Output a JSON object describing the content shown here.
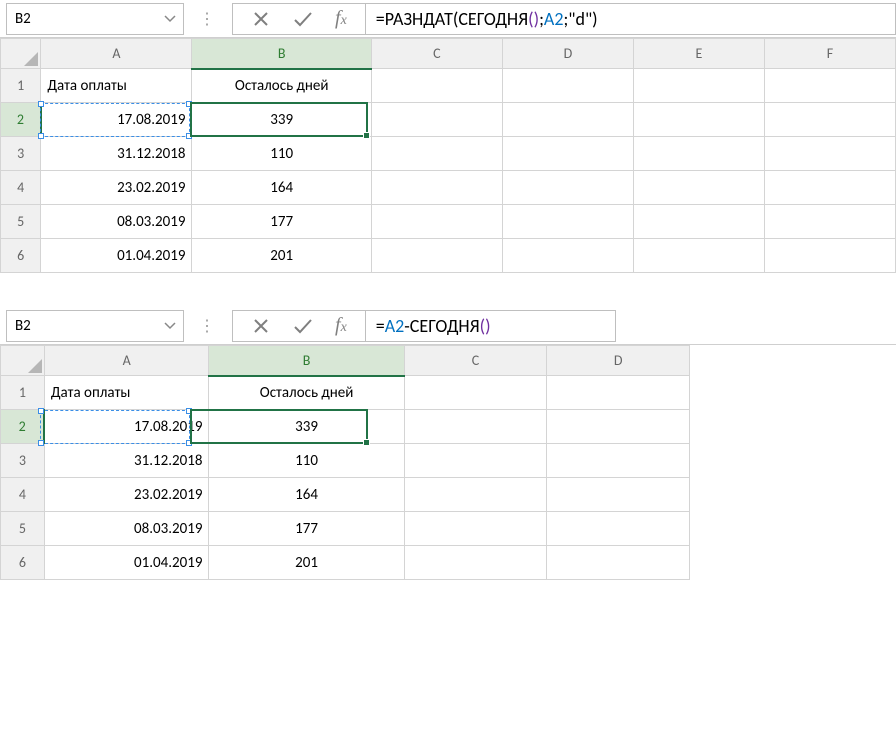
{
  "blocks": [
    {
      "name_box": "B2",
      "formula": {
        "prefix": "=РАЗНДАТ(СЕГОДНЯ",
        "paren_l2": "(",
        "paren_r2": ")",
        "sep1": ";",
        "ref": "A2",
        "sep2": ";",
        "str": "\"d\"",
        "close": ")"
      },
      "columns": [
        "A",
        "B",
        "C",
        "D",
        "E",
        "F"
      ],
      "rows": [
        {
          "n": "1",
          "A": "Дата оплаты",
          "B": "Осталось дней"
        },
        {
          "n": "2",
          "A": "17.08.2019",
          "B": "339"
        },
        {
          "n": "3",
          "A": "31.12.2018",
          "B": "110"
        },
        {
          "n": "4",
          "A": "23.02.2019",
          "B": "164"
        },
        {
          "n": "5",
          "A": "08.03.2019",
          "B": "177"
        },
        {
          "n": "6",
          "A": "01.04.2019",
          "B": "201"
        }
      ]
    },
    {
      "name_box": "B2",
      "formula": {
        "prefix": "=",
        "ref": "A2",
        "mid": "-СЕГОДНЯ",
        "paren_l2": "(",
        "paren_r2": ")"
      },
      "columns": [
        "A",
        "B",
        "C",
        "D"
      ],
      "rows": [
        {
          "n": "1",
          "A": "Дата оплаты",
          "B": "Осталось дней"
        },
        {
          "n": "2",
          "A": "17.08.2019",
          "B": "339"
        },
        {
          "n": "3",
          "A": "31.12.2018",
          "B": "110"
        },
        {
          "n": "4",
          "A": "23.02.2019",
          "B": "164"
        },
        {
          "n": "5",
          "A": "08.03.2019",
          "B": "177"
        },
        {
          "n": "6",
          "A": "01.04.2019",
          "B": "201"
        }
      ]
    }
  ]
}
